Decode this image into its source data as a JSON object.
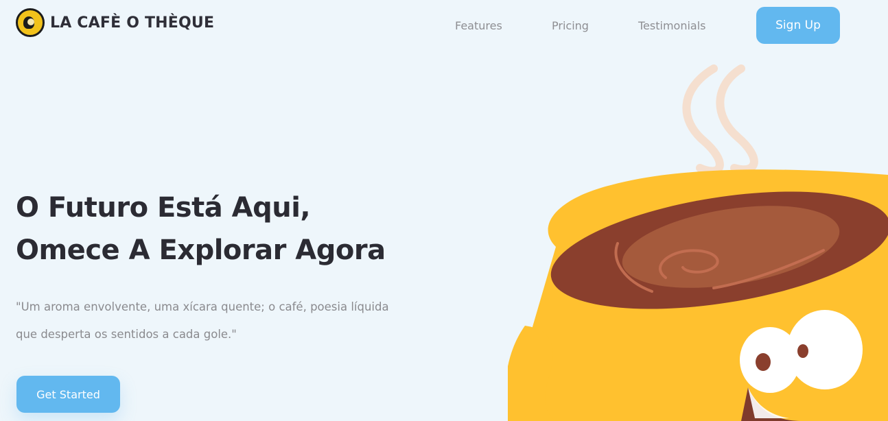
{
  "header": {
    "brand_name": "LA CAFÈ O THÈQUE",
    "logo_icon": "coffee-cup-mascot-logo",
    "nav": [
      {
        "label": "Features"
      },
      {
        "label": "Pricing"
      },
      {
        "label": "Testimonials"
      }
    ],
    "signup_label": "Sign Up"
  },
  "hero": {
    "title_line1": "O Futuro Está Aqui,",
    "title_line2": "Omece A Explorar Agora",
    "text_line1": "\"Um aroma envolvente, uma xícara quente; o café, poesia líquida",
    "text_line2": "que desperta os sentidos a cada gole.\"",
    "cta_label": "Get Started",
    "illustration": "smiling-coffee-cup-illustration"
  },
  "colors": {
    "background": "#eef6fb",
    "accent": "#62b8ef",
    "heading": "#2b2b33",
    "muted": "#8a8a8e",
    "cup": "#ffc12f",
    "coffee": "#8a3f2d",
    "steam": "#f5dfcf"
  }
}
